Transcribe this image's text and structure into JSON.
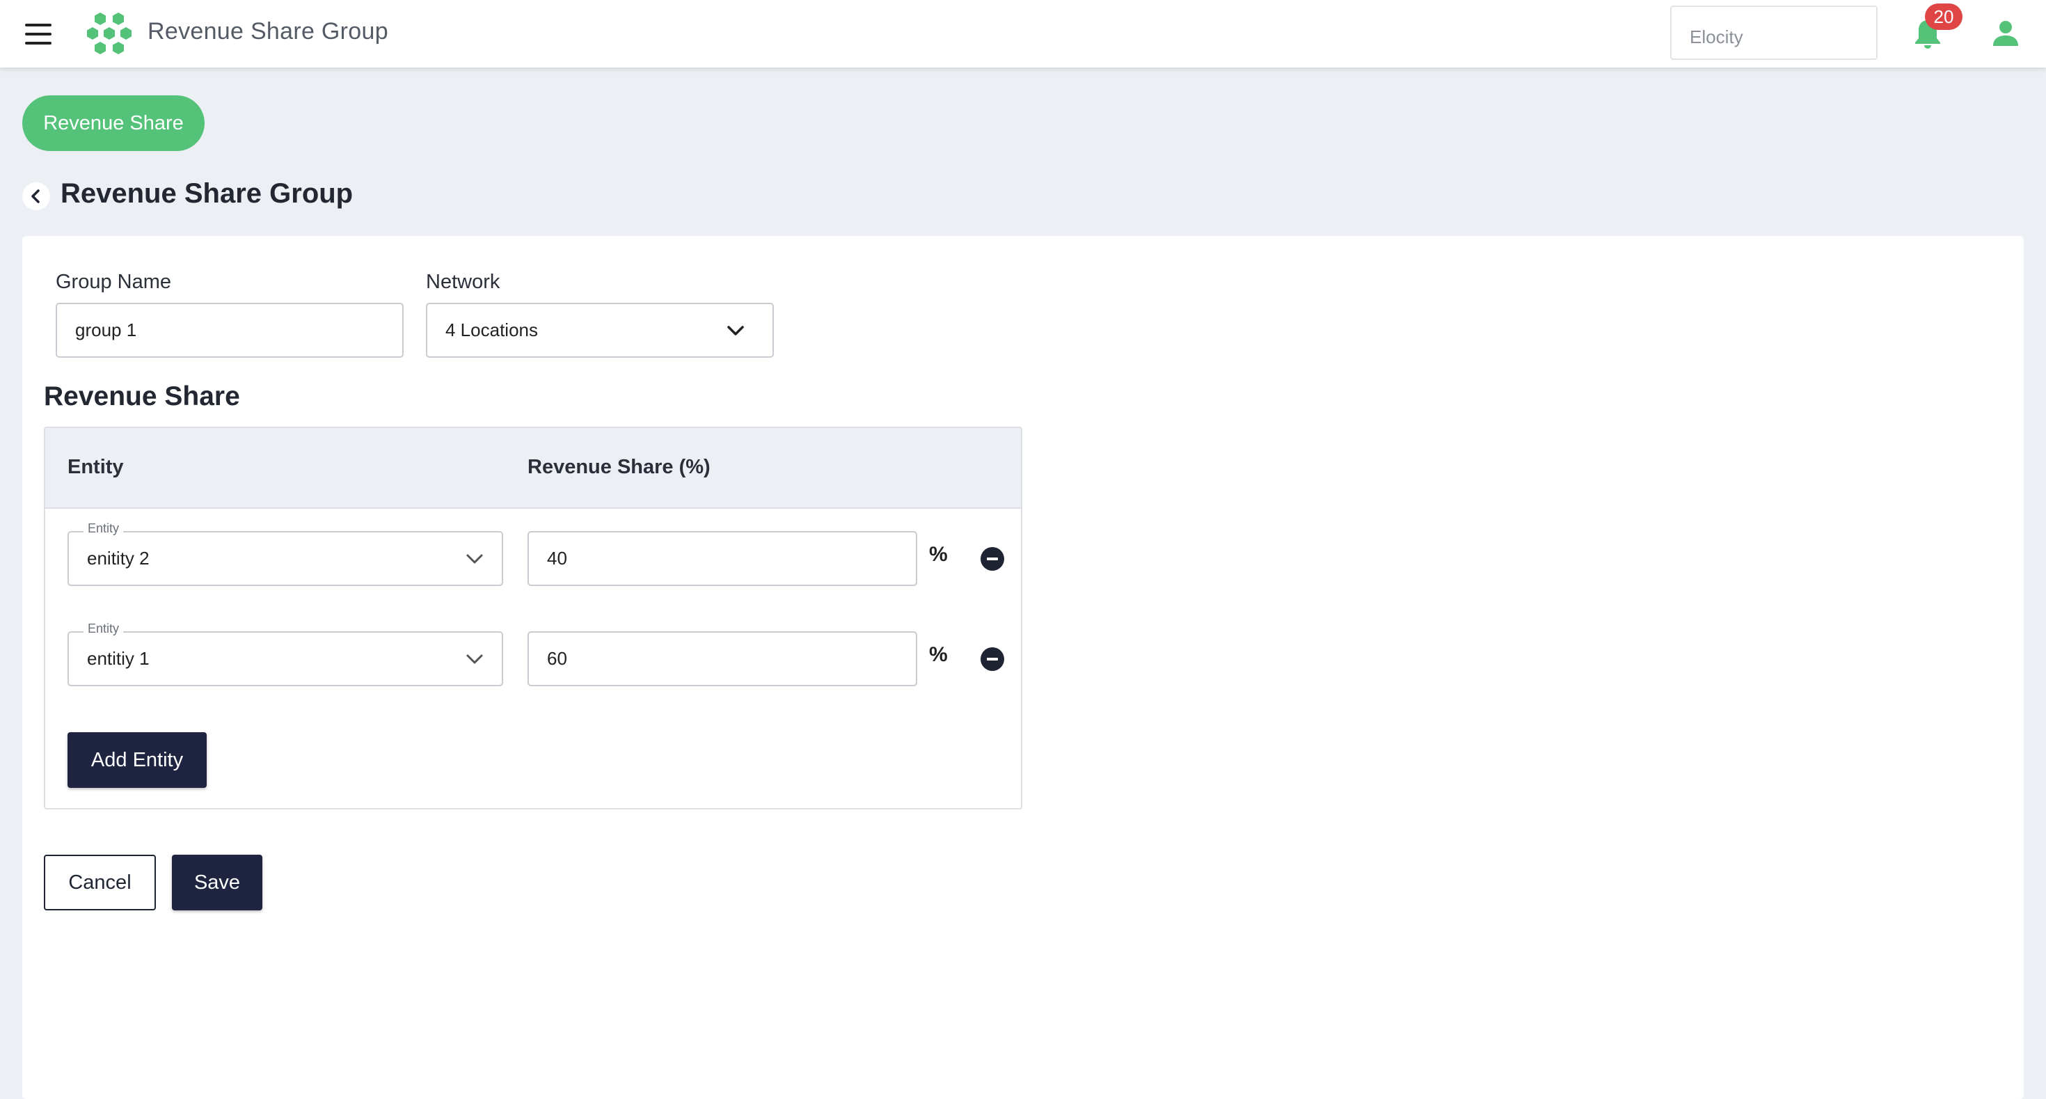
{
  "header": {
    "app_title": "Revenue Share Group",
    "org_selector": "Elocity",
    "notification_count": "20",
    "brand_color": "#54c278"
  },
  "nav": {
    "pill_label": "Revenue Share"
  },
  "page": {
    "title": "Revenue Share Group"
  },
  "form": {
    "group_name_label": "Group Name",
    "group_name_value": "group 1",
    "network_label": "Network",
    "network_value": "4 Locations"
  },
  "revenue_share": {
    "section_title": "Revenue Share",
    "columns": [
      "Entity",
      "Revenue Share (%)"
    ],
    "rows": [
      {
        "entity_label": "Entity",
        "entity": "enitity 2",
        "share": "40",
        "unit": "%"
      },
      {
        "entity_label": "Entity",
        "entity": "entitiy 1",
        "share": "60",
        "unit": "%"
      }
    ],
    "add_button": "Add Entity"
  },
  "actions": {
    "cancel": "Cancel",
    "save": "Save"
  }
}
